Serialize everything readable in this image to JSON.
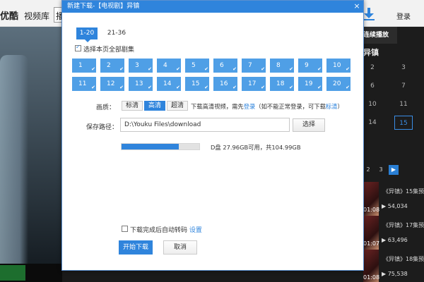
{
  "app": {
    "logo_text": "优酷",
    "nav_item": "视频库",
    "nav_partial": "播",
    "login": "登录"
  },
  "side": {
    "tab_active": "连续播放",
    "show_title": "异镇",
    "episodes": [
      "2",
      "3",
      "6",
      "7",
      "10",
      "11",
      "14",
      "15"
    ],
    "active_episode": "15",
    "pages": [
      "2",
      "3",
      "▶"
    ],
    "items": [
      {
        "duration": "01:08",
        "title": "《异镇》15集预",
        "views": "54,034"
      },
      {
        "duration": "01:07",
        "title": "《异镇》17集预",
        "views": "63,496"
      },
      {
        "duration": "01:08",
        "title": "《异镇》18集预",
        "views": "75,538"
      }
    ]
  },
  "dialog": {
    "title": "新建下载-【电视剧】异镇",
    "close": "×",
    "page_tabs": [
      "1-20",
      "21-36"
    ],
    "select_all_label": "选择本页全部剧集",
    "episodes": [
      "1",
      "2",
      "3",
      "4",
      "5",
      "6",
      "7",
      "8",
      "9",
      "10",
      "11",
      "12",
      "13",
      "14",
      "15",
      "16",
      "17",
      "18",
      "19",
      "20"
    ],
    "quality": {
      "label": "画质：",
      "options": [
        "标清",
        "高清",
        "超清"
      ],
      "selected": "高清",
      "tip_prefix": "下载高清视频，需先",
      "tip_login": "登录",
      "tip_middle": "（如不能正常登录，可下载",
      "tip_sd": "标清",
      "tip_suffix": "）"
    },
    "save_path": {
      "label": "保存路径：",
      "value": "D:\\Youku Files\\download",
      "browse": "选择"
    },
    "disk": {
      "used_fraction": 0.74,
      "text": "D盘 27.96GB可用，共104.99GB"
    },
    "transcode": {
      "label": "下载完成后自动转码",
      "settings": "设置"
    },
    "buttons": {
      "start": "开始下载",
      "cancel": "取消"
    }
  },
  "colors": {
    "accent": "#2f84dc",
    "episode_btn": "#4f9fe6"
  }
}
